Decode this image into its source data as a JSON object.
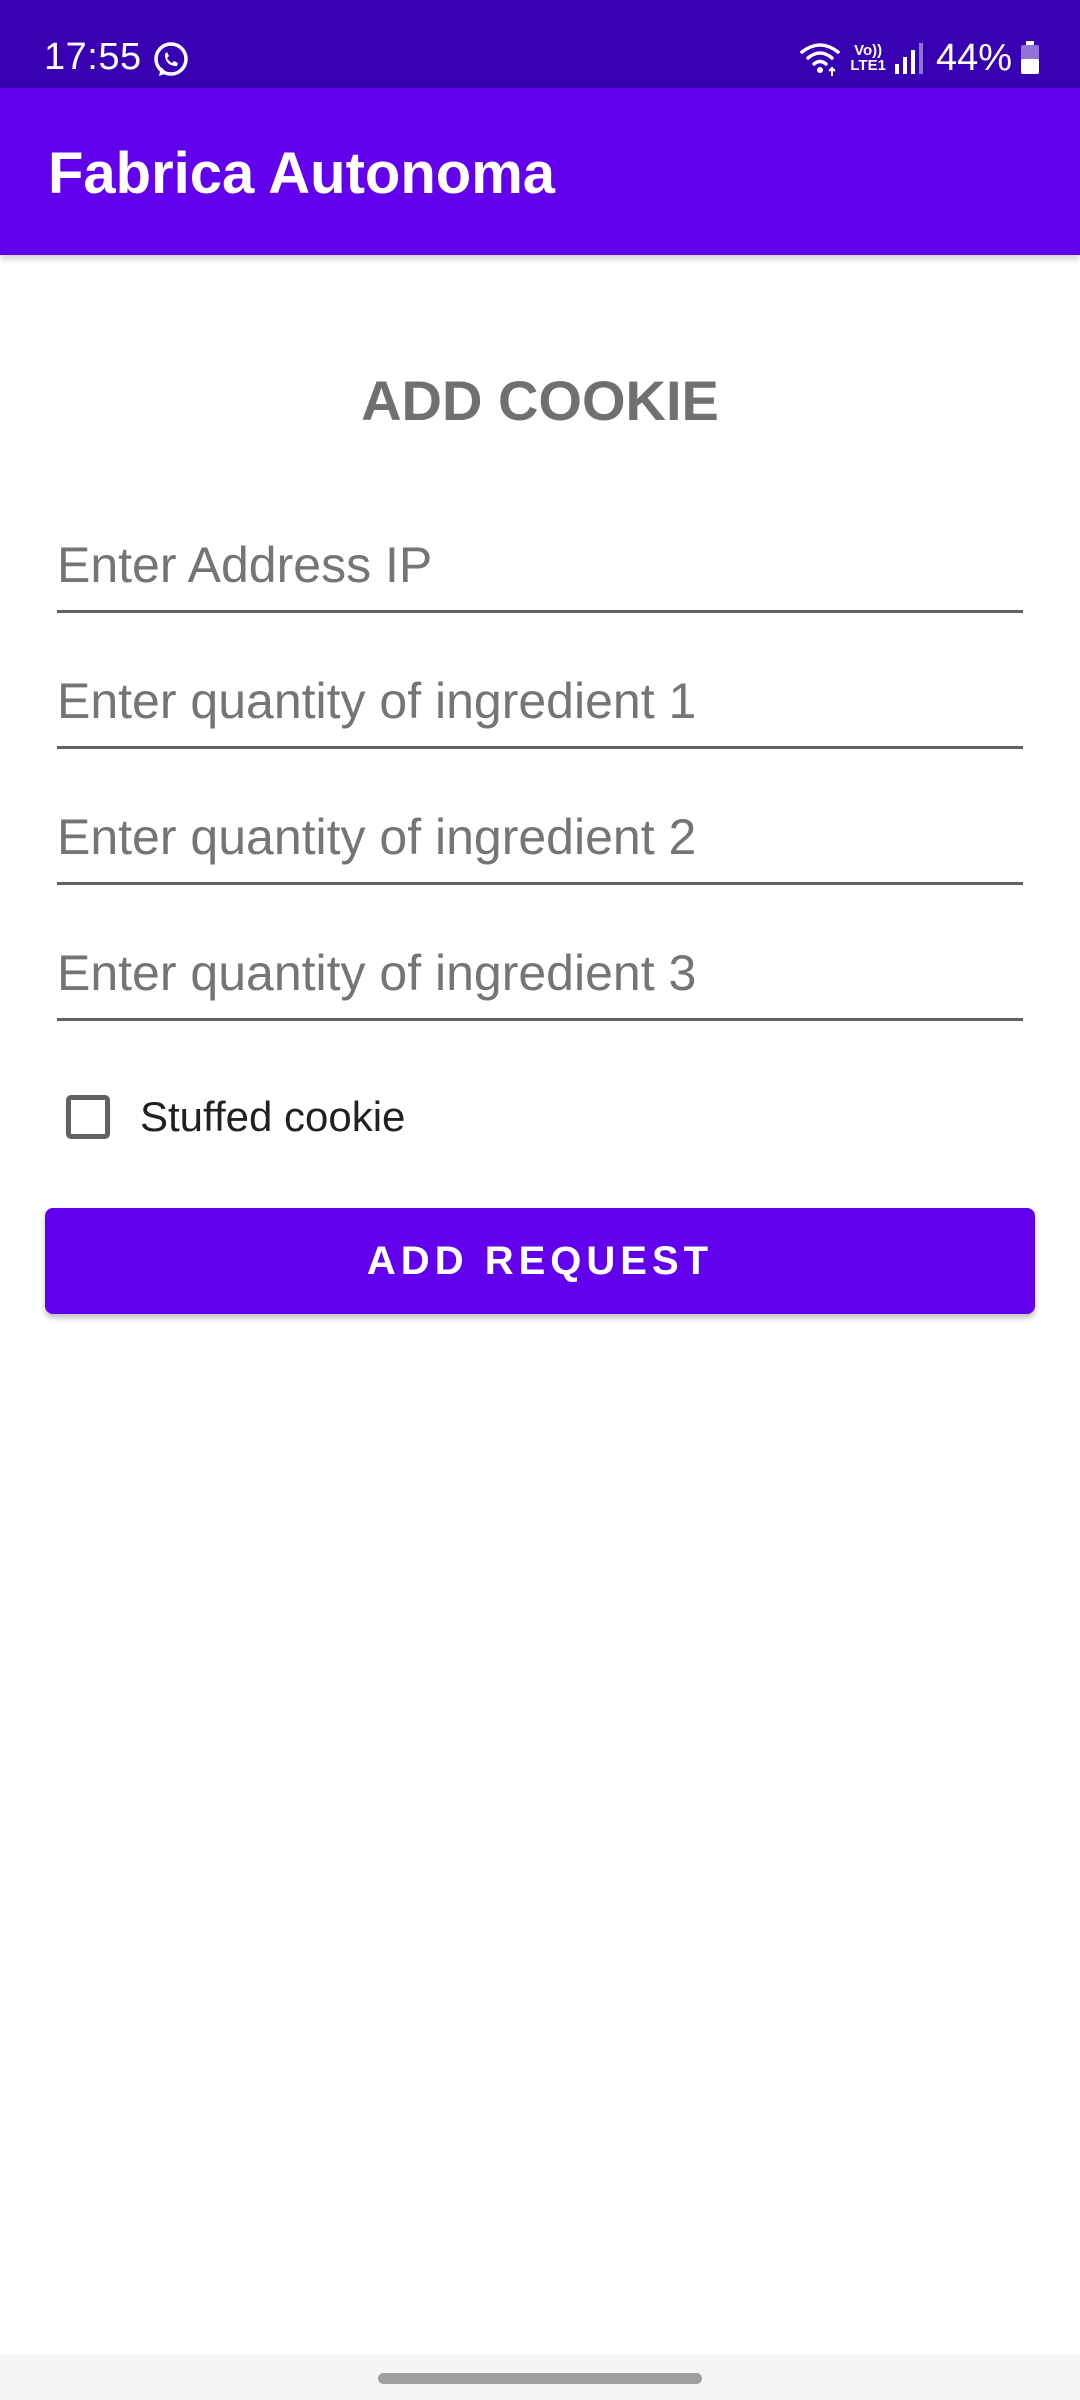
{
  "status_bar": {
    "time": "17:55",
    "notification_icon": "whatsapp-icon",
    "network_label_top": "Vo))",
    "network_label_bottom": "LTE1",
    "battery": "44%"
  },
  "app_bar": {
    "title": "Fabrica Autonoma"
  },
  "form": {
    "title": "ADD COOKIE",
    "fields": [
      {
        "value": "",
        "placeholder": "Enter Address IP"
      },
      {
        "value": "",
        "placeholder": "Enter quantity of ingredient 1"
      },
      {
        "value": "",
        "placeholder": "Enter quantity of ingredient 2"
      },
      {
        "value": "",
        "placeholder": "Enter quantity of ingredient 3"
      }
    ],
    "checkbox": {
      "label": "Stuffed cookie",
      "checked": false
    },
    "submit_label": "ADD REQUEST"
  },
  "colors": {
    "status_bar": "#3700b3",
    "primary": "#6200ee",
    "title_text": "#707070"
  }
}
